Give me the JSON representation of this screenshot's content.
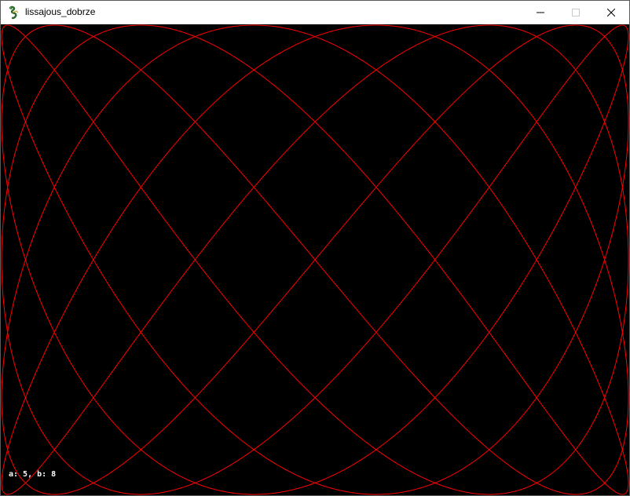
{
  "window": {
    "title": "lissajous_dobrze",
    "icon": "python-icon",
    "controls": [
      "minimize",
      "maximize",
      "close"
    ]
  },
  "canvas": {
    "background": "#000000",
    "curve_color": "#ff0000",
    "label_color": "#ffffff",
    "curve": {
      "type": "lissajous",
      "a": 5,
      "b": 8
    },
    "params_label": "a: 5, b: 8"
  }
}
